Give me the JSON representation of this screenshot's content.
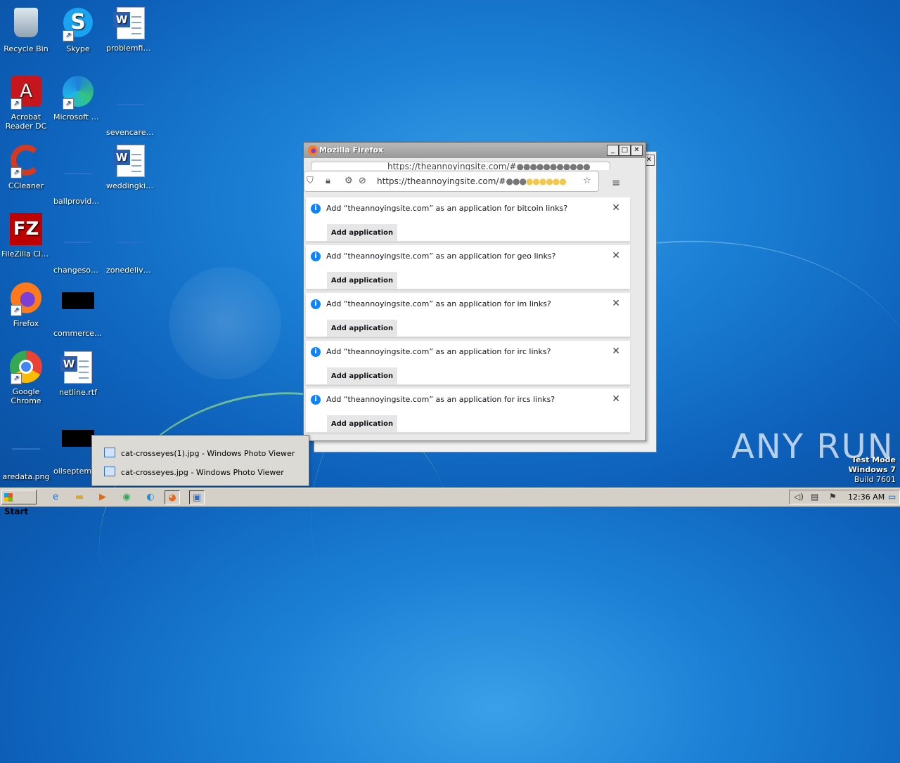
{
  "desktop": {
    "icons": [
      {
        "label": "Recycle Bin"
      },
      {
        "label": "Skype"
      },
      {
        "label": "problemfinal..."
      },
      {
        "label": "Acrobat Reader DC"
      },
      {
        "label": "Microsoft Edge"
      },
      {
        "label": "sevencaree..."
      },
      {
        "label": "CCleaner"
      },
      {
        "label": "ballprovide...."
      },
      {
        "label": "weddingkitc..."
      },
      {
        "label": "FileZilla Client"
      },
      {
        "label": "changesou..."
      },
      {
        "label": "zonedeliver..."
      },
      {
        "label": "Firefox"
      },
      {
        "label": "commerceim..."
      },
      {
        "label": "Google Chrome"
      },
      {
        "label": "netline.rtf"
      },
      {
        "label": "aredata.png"
      },
      {
        "label": "oilseptemb..."
      }
    ]
  },
  "firefox": {
    "title": "Mozilla Firefox",
    "back_url": "https://theannoyingsite.com/#",
    "url": "https://theannoyingsite.com/#",
    "notifications": [
      {
        "message": "Add “theannoyingsite.com” as an application for bitcoin links?",
        "button": "Add application"
      },
      {
        "message": "Add “theannoyingsite.com” as an application for geo links?",
        "button": "Add application"
      },
      {
        "message": "Add “theannoyingsite.com” as an application for im links?",
        "button": "Add application"
      },
      {
        "message": "Add “theannoyingsite.com” as an application for irc links?",
        "button": "Add application"
      },
      {
        "message": "Add “theannoyingsite.com” as an application for ircs links?",
        "button": "Add application"
      }
    ]
  },
  "popup": {
    "items": [
      "cat-crosseyes(1).jpg - Windows Photo Viewer",
      "cat-crosseyes.jpg - Windows Photo Viewer"
    ]
  },
  "watermark": {
    "brand": "ANY RUN",
    "mode": "Test Mode",
    "os": "Windows 7",
    "build": "Build 7601"
  },
  "taskbar": {
    "start": "Start",
    "clock": "12:36 AM"
  }
}
